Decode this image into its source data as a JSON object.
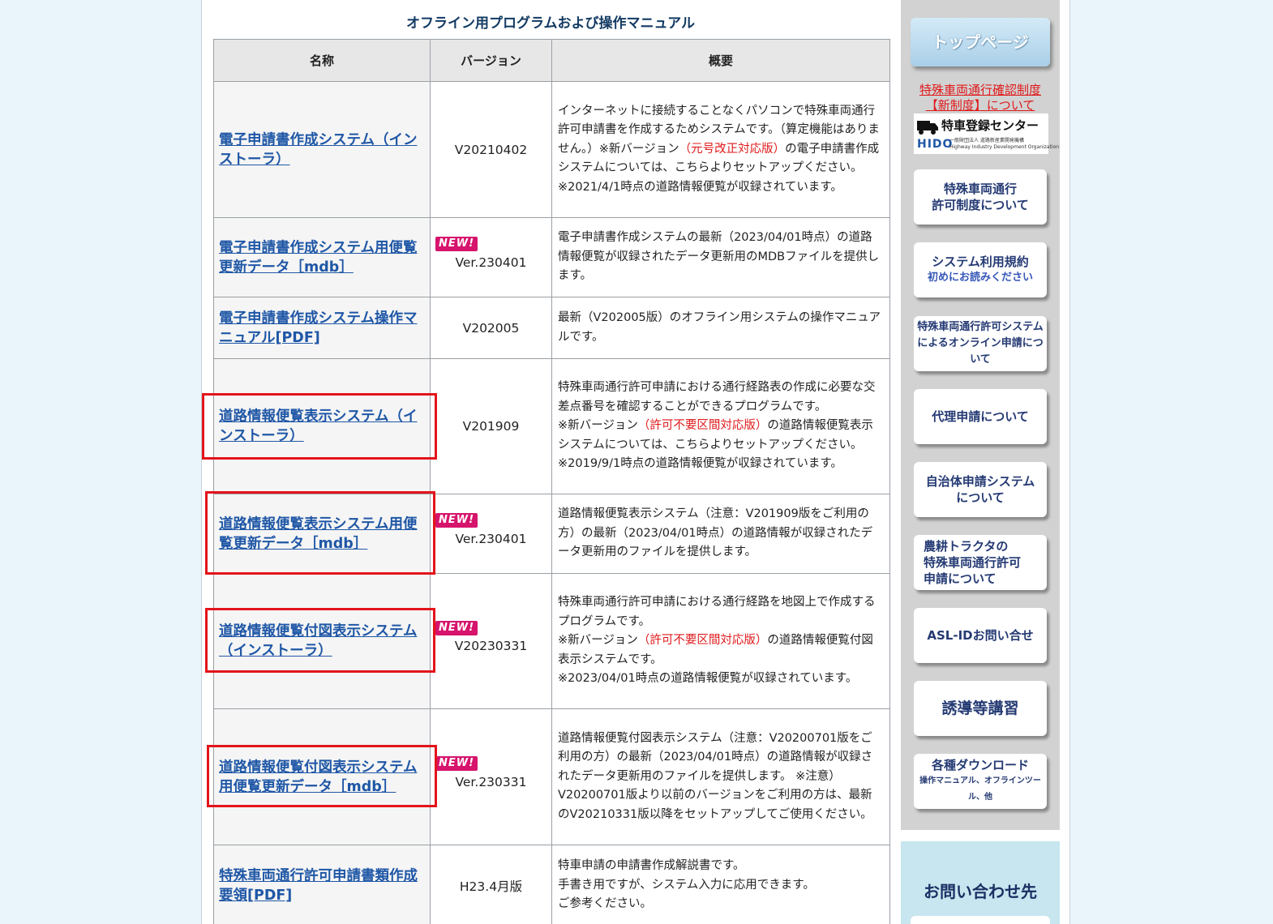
{
  "section_title": "オフライン用プログラムおよび操作マニュアル",
  "table": {
    "headers": [
      "名称",
      "バージョン",
      "概要"
    ],
    "new_label": "NEW!",
    "rows": [
      {
        "name": "電子申請書作成システム（インストーラ）",
        "version": "V20210402",
        "is_new": false,
        "desc": [
          {
            "t": "インターネットに接続することなくパソコンで特殊車両通行許可申請書を作成するためシステムです。（算定機能はありません。）"
          },
          {
            "t": "※新バージョン"
          },
          {
            "r": "（元号改正対応版）"
          },
          {
            "t": "の電子申請書作成システムについては、こちらよりセットアップください。"
          },
          {
            "br": true
          },
          {
            "t": "※2021/4/1時点の道路情報便覧が収録されています。"
          }
        ]
      },
      {
        "name": "電子申請書作成システム用便覧更新データ［mdb］",
        "version": "Ver.230401",
        "is_new": true,
        "desc": [
          {
            "t": "電子申請書作成システムの最新（2023/04/01時点）の道路情報便覧が収録されたデータ更新用のMDBファイルを提供します。"
          }
        ]
      },
      {
        "name": "電子申請書作成システム操作マニュアル[PDF]",
        "version": "V202005",
        "is_new": false,
        "desc": [
          {
            "t": "最新（V202005版）のオフライン用システムの操作マニュアルです。"
          }
        ]
      },
      {
        "name": "道路情報便覧表示システム（インストーラ）",
        "version": "V201909",
        "is_new": false,
        "desc": [
          {
            "t": "特殊車両通行許可申請における通行経路表の作成に必要な交差点番号を確認することができるプログラムです。"
          },
          {
            "br": true
          },
          {
            "t": "※新バージョン"
          },
          {
            "r": "（許可不要区間対応版）"
          },
          {
            "t": "の道路情報便覧表示システムについては、こちらよりセットアップください。"
          },
          {
            "br": true
          },
          {
            "t": "※2019/9/1時点の道路情報便覧が収録されています。"
          }
        ]
      },
      {
        "name": "道路情報便覧表示システム用便覧更新データ［mdb］",
        "version": "Ver.230401",
        "is_new": true,
        "desc": [
          {
            "t": "道路情報便覧表示システム（注意：V201909版をご利用の方）の最新（2023/04/01時点）の道路情報が収録されたデータ更新用のファイルを提供します。"
          }
        ]
      },
      {
        "name": "道路情報便覧付図表示システム（インストーラ）",
        "version": "V20230331",
        "is_new": true,
        "desc": [
          {
            "t": "特殊車両通行許可申請における通行経路を地図上で作成するプログラムです。"
          },
          {
            "br": true
          },
          {
            "t": "※新バージョン"
          },
          {
            "r": "（許可不要区間対応版）"
          },
          {
            "t": "の道路情報便覧付図表示システムです。"
          },
          {
            "br": true
          },
          {
            "t": "※2023/04/01時点の道路情報便覧が収録されています。"
          }
        ]
      },
      {
        "name": "道路情報便覧付図表示システム用便覧更新データ［mdb］",
        "version": "Ver.230331",
        "is_new": true,
        "desc": [
          {
            "t": "道路情報便覧付図表示システム（注意：V20200701版をご利用の方）の最新（2023/04/01時点）の道路情報が収録されたデータ更新用のファイルを提供します。 ※注意）V20200701版より以前のバージョンをご利用の方は、最新のV20210331版以降をセットアップしてご使用ください。"
          }
        ]
      },
      {
        "name": "特殊車両通行許可申請書類作成要領[PDF]",
        "version": "H23.4月版",
        "is_new": false,
        "desc": [
          {
            "t": "特車申請の申請書作成解説書です。"
          },
          {
            "br": true
          },
          {
            "t": "手書き用ですが、システム入力に応用できます。"
          },
          {
            "br": true
          },
          {
            "t": "ご参考ください。"
          }
        ]
      }
    ]
  },
  "sidebar": {
    "top_button": "トップページ",
    "notice_line1": "特殊車両通行確認制度",
    "notice_line2": "【新制度】について",
    "center_name": "特車登録センター",
    "center_brand": "HIDO",
    "center_org": "一般財団法人 道路新産業開発機構",
    "center_org_en": "Highway Industry Development Organization",
    "buttons": [
      {
        "l1": "特殊車両通行",
        "l2": "許可制度について"
      },
      {
        "l1": "システム利用規約",
        "sub": "初めにお読みください"
      },
      {
        "l1": "特殊車両通行許可システム",
        "l2": "によるオンライン申請について",
        "small": true
      },
      {
        "l1": "代理申請について"
      },
      {
        "l1": "自治体申請システム",
        "l2": "について"
      },
      {
        "l1": "農耕トラクタの",
        "l2": "特殊車両通行許可",
        "l3": "申請について",
        "left": true
      },
      {
        "l1": "ASL-IDお問い合せ"
      },
      {
        "l1": "誘導等講習",
        "big": true
      },
      {
        "l1": "各種ダウンロード",
        "tiny": "操作マニュアル、オフラインツール、他"
      }
    ],
    "contact_title": "お問い合わせ先"
  }
}
